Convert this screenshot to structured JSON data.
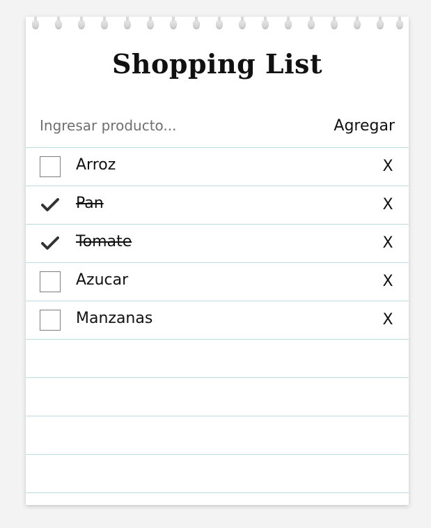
{
  "app": {
    "title": "Shopping List"
  },
  "add_form": {
    "input_placeholder": "Ingresar producto...",
    "input_value": "",
    "add_label": "Agregar"
  },
  "items": [
    {
      "label": "Arroz",
      "checked": false,
      "delete_label": "X"
    },
    {
      "label": "Pan",
      "checked": true,
      "delete_label": "X"
    },
    {
      "label": "Tomate",
      "checked": true,
      "delete_label": "X"
    },
    {
      "label": "Azucar",
      "checked": false,
      "delete_label": "X"
    },
    {
      "label": "Manzanas",
      "checked": false,
      "delete_label": "X"
    }
  ],
  "icons": {
    "check": "check-icon",
    "delete": "x-icon",
    "holes": "ring-hole-icon"
  },
  "colors": {
    "page_bg": "#f3f3f3",
    "paper": "#ffffff",
    "rule_line": "#bfdbe3",
    "text": "#111111"
  }
}
